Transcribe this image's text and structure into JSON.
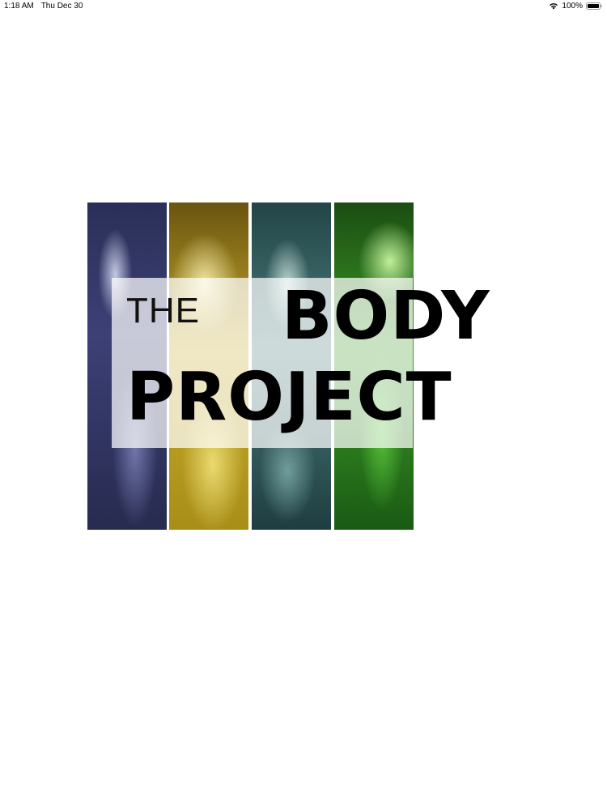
{
  "status_bar": {
    "time": "1:18 AM",
    "date": "Thu Dec 30",
    "battery": "100%",
    "wifi_icon": "wifi-icon",
    "battery_icon": "battery-icon"
  },
  "logo": {
    "word_the": "THE",
    "word_body": "BODY",
    "word_project": "PROJECT",
    "strip_colors": [
      "#3c4076",
      "#c7ac2c",
      "#4b7c7c",
      "#3e9c27"
    ]
  }
}
